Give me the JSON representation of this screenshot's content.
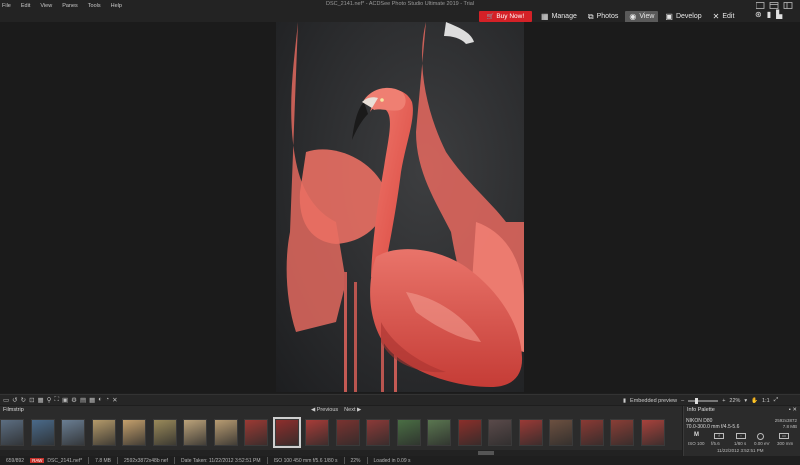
{
  "menu": [
    "File",
    "Edit",
    "View",
    "Panes",
    "Tools",
    "Help"
  ],
  "window_title": "DSC_2141.nef* - ACDSee Photo Studio Ultimate 2019 - Trial",
  "buy_now": "Buy Now!",
  "modes": [
    {
      "label": "Manage",
      "icon": "grid-icon"
    },
    {
      "label": "Photos",
      "icon": "photos-icon"
    },
    {
      "label": "View",
      "icon": "eye-icon",
      "active": true
    },
    {
      "label": "Develop",
      "icon": "develop-icon"
    },
    {
      "label": "Edit",
      "icon": "edit-icon"
    }
  ],
  "view_toolbar": {
    "preview_mode": "Embedded preview",
    "zoom": "22%",
    "zoom_fill": 0.25,
    "ratio": "1:1"
  },
  "filmstrip": {
    "tab": "Filmstrip",
    "previous": "Previous",
    "next": "Next",
    "thumb_colors": [
      "#5c6e82",
      "#4a6a8a",
      "#6a7e93",
      "#b49a6a",
      "#c4a06c",
      "#9a8a5a",
      "#bca37a",
      "#b89c72",
      "#9c3a34",
      "#8e2e2c",
      "#a83c38",
      "#7a3330",
      "#8c3a38",
      "#4a6e44",
      "#5a7650",
      "#8b2f2a",
      "#5a4a4a",
      "#9a3a36",
      "#6c5040",
      "#8a3a34",
      "#8a3e36",
      "#a8423c"
    ],
    "selected_index": 9
  },
  "info_palette": {
    "title": "Info Palette",
    "camera": "NIKON D80",
    "lens": "70.0-300.0 mm f/4.5-5.6",
    "dimensions": "2592x3872",
    "filesize": "7.8 MB",
    "mode": "M",
    "iso": "ISO 100",
    "aperture": "f/5.6",
    "shutter": "1/80 s",
    "ev": "0.00 eV",
    "focal": "300 mm",
    "date": "11/22/2012 3:52:51 PM"
  },
  "status": {
    "index": "659/892",
    "format": "RAW",
    "filename": "DSC_2141.nef*",
    "size": "7.8 MB",
    "dims": "2592x3872x48b nef",
    "date_taken": "Date Taken: 11/22/2012 3:52:51 PM",
    "exposure": "ISO 100  450 mm  f/5.6  1/80 s",
    "zoom": "22%",
    "loaded": "Loaded in 0.09 s"
  }
}
